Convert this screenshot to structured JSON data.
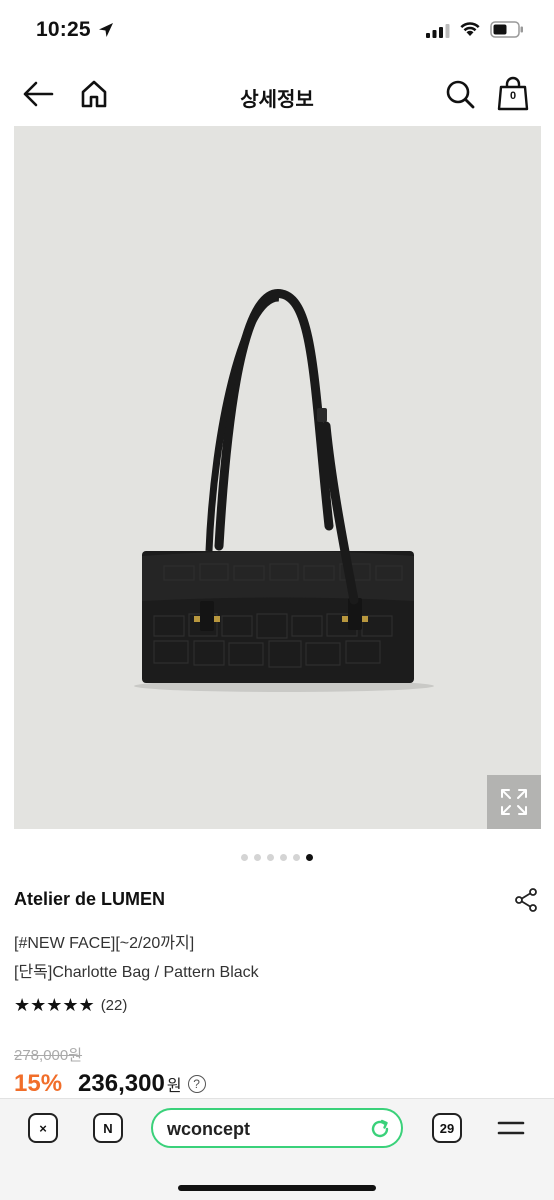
{
  "status": {
    "time": "10:25"
  },
  "header": {
    "title": "상세정보",
    "cart_count": "0"
  },
  "gallery": {
    "total_images": 6,
    "active_index": 5
  },
  "product": {
    "brand": "Atelier de LUMEN",
    "tag": "[#NEW FACE][~2/20까지]",
    "name": "[단독]Charlotte Bag / Pattern Black",
    "stars": "★★★★★",
    "review_count": "(22)",
    "original_price": "278,000원",
    "discount": "15%",
    "sale_price": "236,300",
    "currency": "원",
    "info": "?"
  },
  "browser": {
    "close_label": "×",
    "naver_label": "N",
    "url": "wconcept",
    "tab_count": "29",
    "url_border_color": "#3ad17a"
  },
  "colors": {
    "discount": "#f16e2a",
    "image_bg": "#e3e3e0"
  }
}
